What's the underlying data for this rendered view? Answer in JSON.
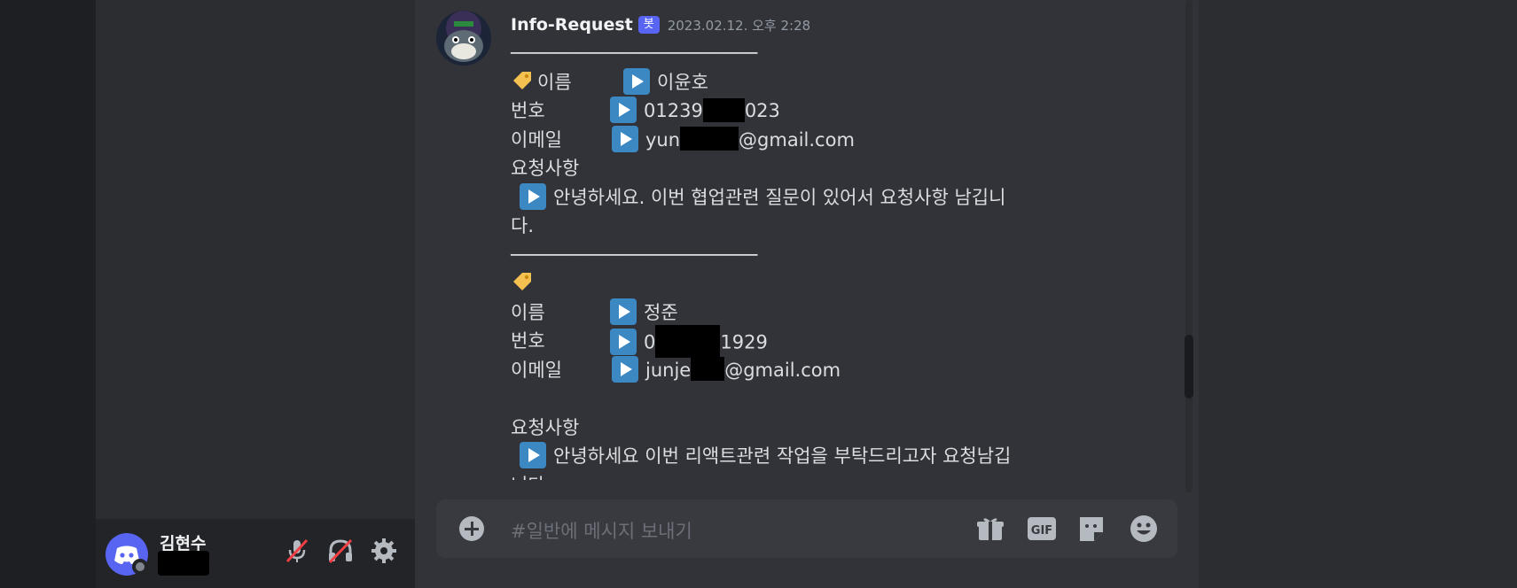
{
  "message": {
    "author": "Info-Request",
    "bot_badge": "봇",
    "timestamp": "2023.02.12. 오후 2:28",
    "divider": "──────────────────────",
    "entry1": {
      "name_label": "이름",
      "name_value": "이윤호",
      "phone_label": "번호",
      "phone_prefix": "01239",
      "phone_suffix": "023",
      "email_label": "이메일",
      "email_prefix": "yun",
      "email_suffix": "@gmail.com",
      "request_label": "요청사항",
      "request_line1": "안녕하세요. 이번 협업관련 질문이 있어서 요청사항 남깁니",
      "request_line2": "다."
    },
    "entry2": {
      "name_label": "이름",
      "name_value": "정준",
      "phone_label": "번호",
      "phone_prefix": "0",
      "phone_suffix": "1929",
      "email_label": "이메일",
      "email_prefix": "junje",
      "email_suffix": "@gmail.com",
      "request_label": "요청사항",
      "request_line1": "안녕하세요 이번 리액트관련 작업을 부탁드리고자 요청남깁",
      "request_line2": "니다"
    }
  },
  "composer": {
    "placeholder": "#일반에 메시지 보내기",
    "icons": [
      "add-circle-icon",
      "gift-icon",
      "gif-icon",
      "sticker-icon",
      "emoji-icon"
    ]
  },
  "user_panel": {
    "username": "김현수",
    "icons": [
      "discord-logo-icon",
      "mic-muted-icon",
      "headphones-deafened-icon",
      "gear-icon"
    ]
  },
  "colors": {
    "accent": "#5865f2",
    "chat_bg": "#313338",
    "sidebar_bg": "#2b2d31",
    "play_button": "#3b88c3",
    "muted_red": "#f23f43"
  }
}
